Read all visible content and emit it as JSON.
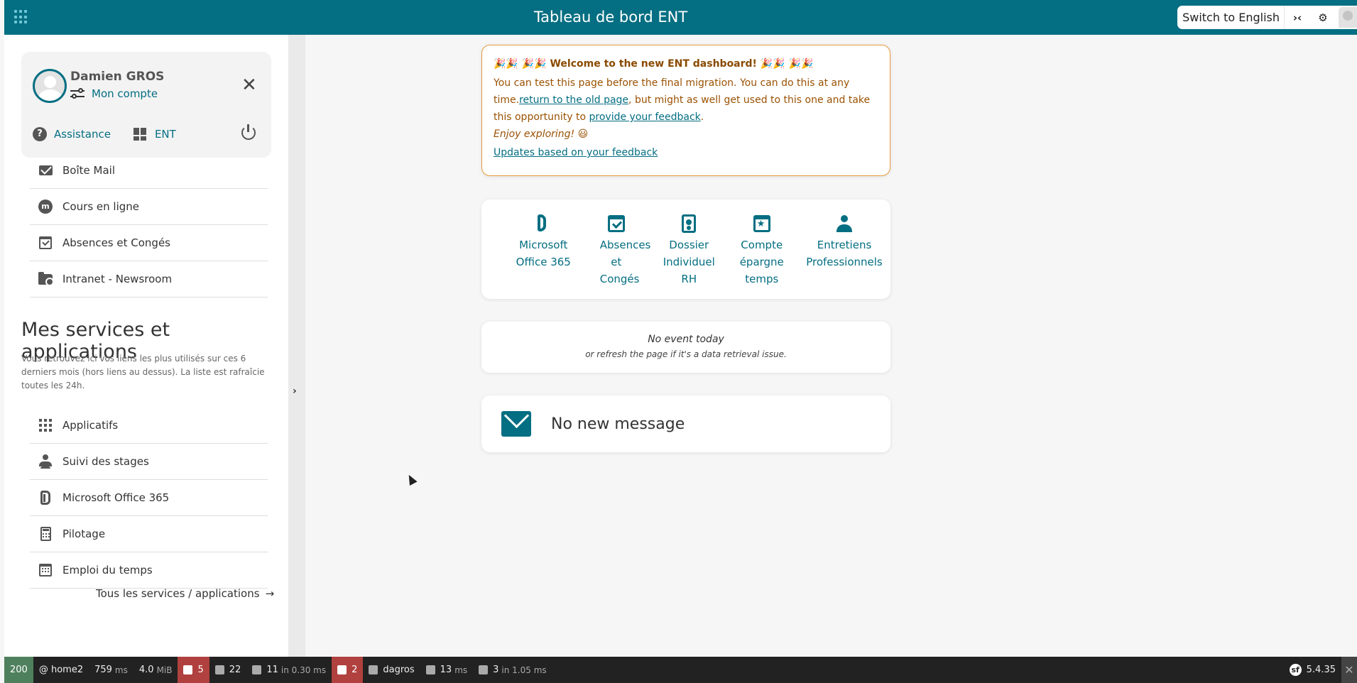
{
  "header": {
    "title": "Tableau de bord ENT",
    "switch_lang": "Switch to English",
    "collapse_icon": "›‹",
    "settings_icon": "⚙"
  },
  "user": {
    "name": "Damien GROS",
    "account_label": "Mon compte",
    "assistance": "Assistance",
    "ent": "ENT"
  },
  "nav_top": [
    {
      "label": "Boîte Mail",
      "icon": "mail-icon"
    },
    {
      "label": "Cours en ligne",
      "icon": "moodle-icon"
    },
    {
      "label": "Absences et Congés",
      "icon": "calendar-check-icon"
    },
    {
      "label": "Intranet - Newsroom",
      "icon": "folder-lock-icon"
    }
  ],
  "services": {
    "title": "Mes services et applications",
    "description": "Vous retrouvez ici vos liens les plus utilisés sur ces 6 derniers mois (hors liens au dessus). La liste est rafraîcie toutes les 24h.",
    "items": [
      {
        "label": "Applicatifs",
        "icon": "apps-grid-icon"
      },
      {
        "label": "Suivi des stages",
        "icon": "person-desk-icon"
      },
      {
        "label": "Microsoft Office 365",
        "icon": "office-icon"
      },
      {
        "label": "Pilotage",
        "icon": "calculator-icon"
      },
      {
        "label": "Emploi du temps",
        "icon": "calendar-icon"
      }
    ],
    "all_link": "Tous les services / applications",
    "all_arrow": "→"
  },
  "welcome": {
    "heading": "🎉🎉 🎉🎉 Welcome to the new ENT dashboard! 🎉🎉 🎉🎉",
    "line1": "You can test this page before the final migration. You can do this at any time.",
    "link_old": "return to the old page",
    "line2": ", but might as well get used to this one and take this opportunity to ",
    "link_feedback": "provide your feedback",
    "line2_end": ".",
    "enjoy": "Enjoy exploring! 😃",
    "updates_link": "Updates based on your feedback"
  },
  "shortcuts": [
    {
      "label": "Microsoft Office 365",
      "icon": "office-icon"
    },
    {
      "label": "Absences et Congés",
      "icon": "calendar-check-icon"
    },
    {
      "label": "Dossier Individuel RH",
      "icon": "id-badge-icon"
    },
    {
      "label": "Compte épargne temps",
      "icon": "calendar-star-icon"
    },
    {
      "label": "Entretiens Professionnels",
      "icon": "professional-icon"
    }
  ],
  "events": {
    "none": "No event today",
    "hint": "or refresh the page if it's a data retrieval issue."
  },
  "messages": {
    "none": "No new message"
  },
  "debug_toolbar": {
    "status": "200",
    "route": "@ home2",
    "time": "759",
    "time_unit": "ms",
    "memory": "4.0",
    "memory_unit": "MiB",
    "form_count": "5",
    "logs_count": "22",
    "db_queries": "11",
    "db_in": "in 0.30 ms",
    "trans_count": "2",
    "user": "dagros",
    "twig_time": "13",
    "twig_unit": "ms",
    "cache": "3",
    "cache_in": "in 1.05 ms",
    "version": "5.4.35",
    "close": "✕"
  },
  "colors": {
    "primary": "#046e82",
    "warning_border": "#e79a3e",
    "toolbar_bg": "#222222"
  }
}
